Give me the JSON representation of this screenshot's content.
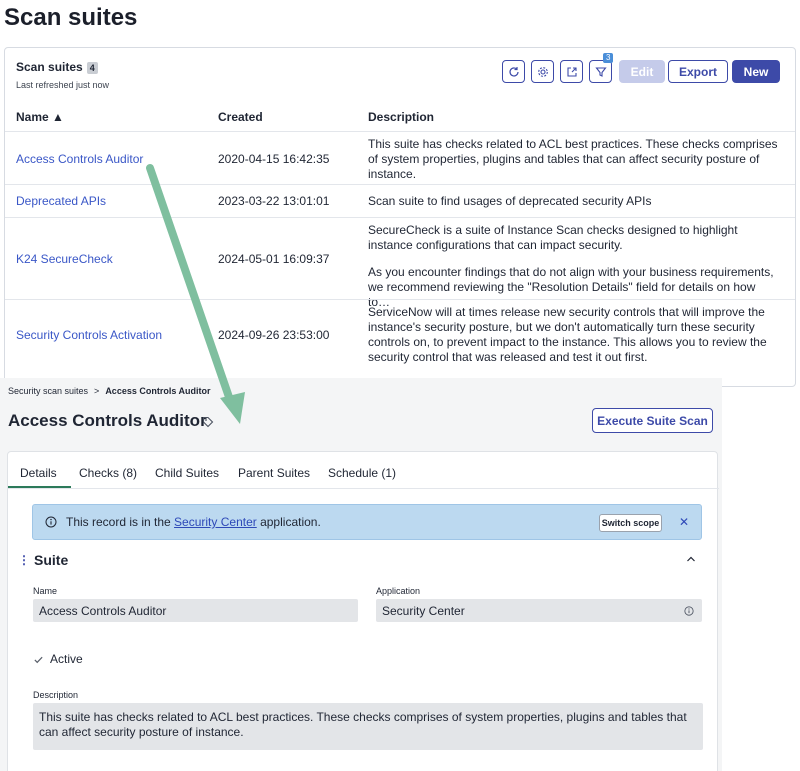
{
  "page": {
    "title": "Scan suites"
  },
  "list": {
    "title": "Scan suites",
    "count": "4",
    "subtitle": "Last refreshed just now",
    "filter_badge": "3",
    "edit_label": "Edit",
    "export_label": "Export",
    "new_label": "New",
    "icons": [
      "refresh-icon",
      "gear-icon",
      "export-icon",
      "filter-icon"
    ],
    "columns": {
      "name": "Name ▲",
      "created": "Created",
      "description": "Description"
    },
    "rows": [
      {
        "name": "Access Controls Auditor",
        "created": "2020-04-15 16:42:35",
        "description": "This suite has checks related to ACL best practices. These checks comprises of system properties, plugins and tables that can affect security posture of instance."
      },
      {
        "name": "Deprecated APIs",
        "created": "2023-03-22 13:01:01",
        "description": "Scan suite to find usages of deprecated security APIs"
      },
      {
        "name": "K24 SecureCheck",
        "created": "2024-05-01 16:09:37",
        "description_p1": "SecureCheck is a suite of Instance Scan checks designed to highlight instance configurations that can impact security.",
        "description_p2": "As you encounter findings that do not align with your business requirements, we recommend reviewing the \"Resolution Details\" field for details on how to…"
      },
      {
        "name": "Security Controls Activation",
        "created": "2024-09-26 23:53:00",
        "description": "ServiceNow will at times release new security controls that will improve the instance's security posture, but we don't automatically turn these security controls on, to prevent impact to the instance. This allows you to review the security control that was released and test it out first."
      }
    ]
  },
  "record": {
    "breadcrumb_parent": "Security scan suites",
    "breadcrumb_separator": ">",
    "breadcrumb_current": "Access Controls Auditor",
    "title": "Access Controls Auditor",
    "execute_label": "Execute Suite Scan",
    "tabs": [
      "Details",
      "Checks (8)",
      "Child Suites",
      "Parent Suites",
      "Schedule (1)"
    ],
    "banner": {
      "prefix": "This record is in the ",
      "link": "Security Center",
      "suffix": " application.",
      "switch_label": "Switch scope",
      "close": "✕"
    },
    "section_title": "Suite",
    "fields": {
      "name_label": "Name",
      "name_value": "Access Controls Auditor",
      "application_label": "Application",
      "application_value": "Security Center",
      "active_label": "Active",
      "active_checked": true,
      "description_label": "Description",
      "description_value": "This suite has checks related to ACL best practices. These checks comprises of system properties, plugins and tables that can affect security posture of instance."
    }
  },
  "colors": {
    "accent": "#3d4aa8",
    "link": "#3a57c7",
    "arrow": "#7fbf9f",
    "banner": "#bcd9f0"
  }
}
